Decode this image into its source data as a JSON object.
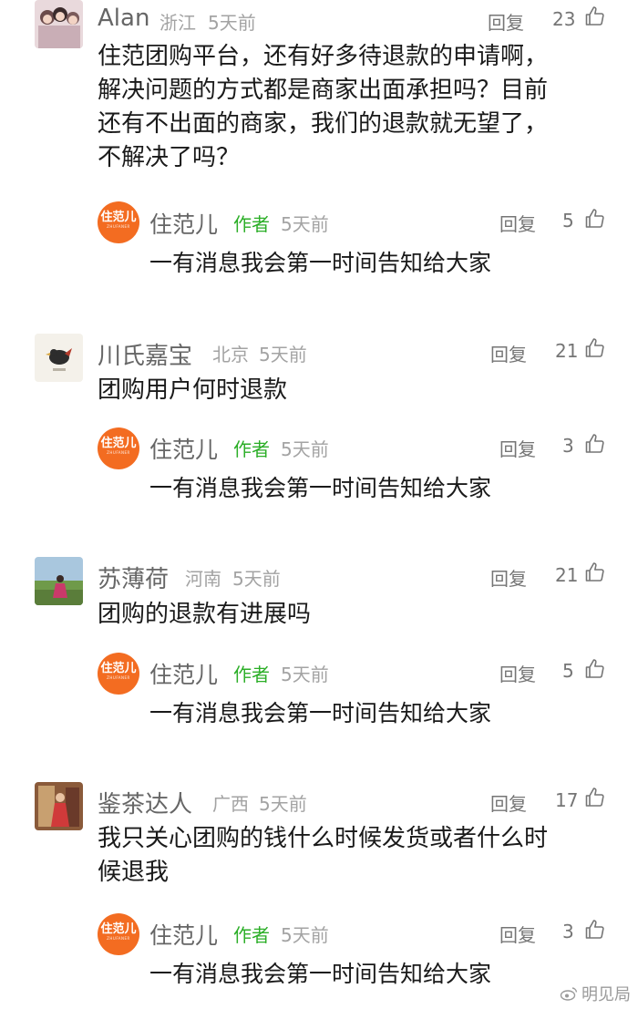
{
  "reply_label": "回复",
  "author_tag": "作者",
  "comments": [
    {
      "user": "Alan",
      "region": "浙江",
      "time": "5天前",
      "likes": "23",
      "avatar": "group-photo-avatar",
      "text": [
        "住范团购平台，还有好多待退款的申请啊，",
        "解决问题的方式都是商家出面承担吗？目前",
        "还有不出面的商家，我们的退款就无望了，",
        "不解决了吗？"
      ],
      "reply": {
        "user": "住范儿",
        "time": "5天前",
        "likes": "5",
        "text": "一有消息我会第一时间告知给大家"
      }
    },
    {
      "user": "川氏嘉宝",
      "region": "北京",
      "time": "5天前",
      "likes": "21",
      "avatar": "bird-logo-avatar",
      "text": [
        "团购用户何时退款"
      ],
      "reply": {
        "user": "住范儿",
        "time": "5天前",
        "likes": "3",
        "text": "一有消息我会第一时间告知给大家"
      }
    },
    {
      "user": "苏薄荷",
      "region": "河南",
      "time": "5天前",
      "likes": "21",
      "avatar": "landscape-photo-avatar",
      "text": [
        "团购的退款有进展吗"
      ],
      "reply": {
        "user": "住范儿",
        "time": "5天前",
        "likes": "5",
        "text": "一有消息我会第一时间告知给大家"
      }
    },
    {
      "user": "鉴茶达人",
      "region": "广西",
      "time": "5天前",
      "likes": "17",
      "avatar": "person-photo-avatar",
      "text": [
        "我只关心团购的钱什么时候发货或者什么时",
        "候退我"
      ],
      "reply": {
        "user": "住范儿",
        "time": "5天前",
        "likes": "3",
        "text": "一有消息我会第一时间告知给大家"
      }
    }
  ],
  "reply_avatar_logo": "住范儿",
  "reply_avatar_sub": "ZHUFANER",
  "watermark": "明见局",
  "colors": {
    "author_green": "#2bae27",
    "brand_orange": "#f36c21",
    "meta_gray": "#a3a3a3"
  }
}
